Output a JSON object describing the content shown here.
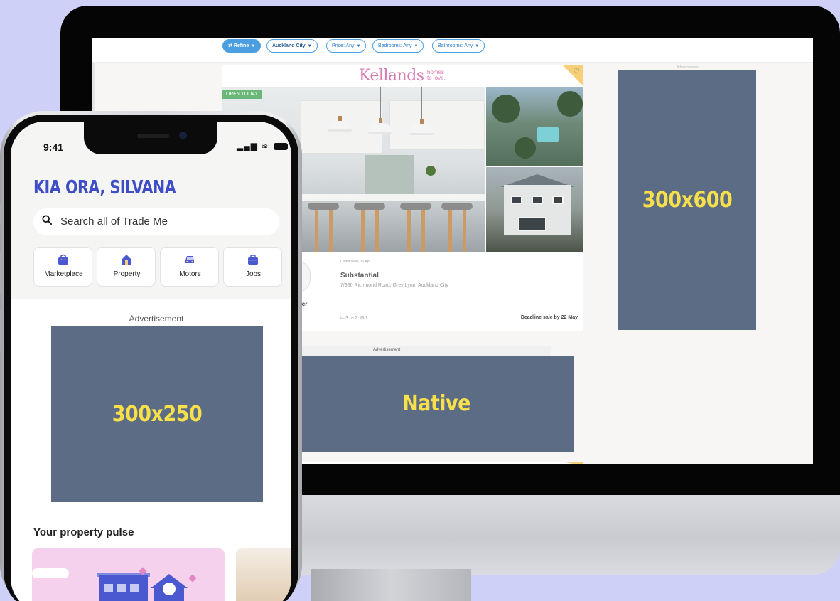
{
  "desktop": {
    "filters": [
      {
        "label": "Refine",
        "style": "primary"
      },
      {
        "label": "Auckland City",
        "style": "bold"
      },
      {
        "label": "Price: Any",
        "style": "normal"
      },
      {
        "label": "Bedrooms: Any",
        "style": "normal"
      },
      {
        "label": "Bathrooms: Any",
        "style": "normal"
      }
    ],
    "listing": {
      "agency_logo": "Kellands",
      "agency_tagline_1": "homes",
      "agency_tagline_2": "to love.",
      "badge": "OPEN TODAY",
      "listed": "Listed Wed, 30 Apr",
      "title": "Substantial",
      "address": "7/386 Richmond Road, Grey Lynn, Auckland City",
      "features": "⊨3  ⌐2  ⊟1",
      "deadline": "Deadline sale by 22 May",
      "agent_name": "aeder",
      "agent_sub": "ed"
    },
    "ad_sidebar": {
      "label": "Advertisement",
      "size": "300x600"
    },
    "ad_native": {
      "label": "Advertisement",
      "text": "Native"
    }
  },
  "phone": {
    "time": "9:41",
    "greeting": "KIA ORA, SILVANA",
    "search_placeholder": "Search all of Trade Me",
    "categories": [
      {
        "label": "Marketplace",
        "icon": "marketplace-icon",
        "color": "#4a59d0"
      },
      {
        "label": "Property",
        "icon": "property-icon",
        "color": "#4a59d0"
      },
      {
        "label": "Motors",
        "icon": "motors-icon",
        "color": "#4a59d0"
      },
      {
        "label": "Jobs",
        "icon": "jobs-icon",
        "color": "#4a59d0"
      }
    ],
    "ad": {
      "label": "Advertisement",
      "size": "300x250"
    },
    "pulse_title": "Your property pulse"
  },
  "colors": {
    "background": "#cfd0f7",
    "ad_block": "#5d6c85",
    "ad_text": "#f8e04a",
    "brand_blue": "#3f4ec7",
    "chip_blue": "#4b9fe1"
  }
}
